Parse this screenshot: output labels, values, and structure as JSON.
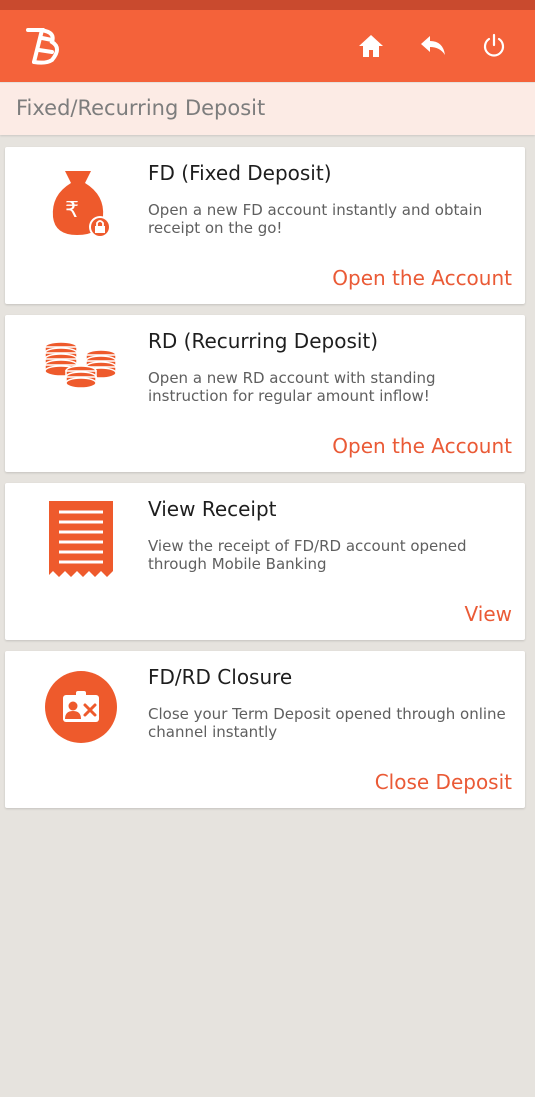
{
  "header": {
    "logo": "bank-of-baroda-logo",
    "icons": [
      "home-icon",
      "back-icon",
      "power-icon"
    ],
    "brand_color": "#f4623a"
  },
  "page": {
    "title": "Fixed/Recurring Deposit"
  },
  "cards": [
    {
      "icon": "money-bag-icon",
      "title": "FD (Fixed Deposit)",
      "description": "Open a new FD account instantly and obtain receipt on the go!",
      "action": "Open the Account"
    },
    {
      "icon": "coin-stack-icon",
      "title": "RD (Recurring Deposit)",
      "description": "Open a new RD account with standing instruction for regular amount inflow!",
      "action": "Open the Account"
    },
    {
      "icon": "receipt-icon",
      "title": "View Receipt",
      "description": "View the receipt of FD/RD account opened through Mobile Banking",
      "action": "View"
    },
    {
      "icon": "id-card-close-icon",
      "title": "FD/RD Closure",
      "description": "Close your Term Deposit opened through online channel instantly",
      "action": "Close Deposit"
    }
  ]
}
